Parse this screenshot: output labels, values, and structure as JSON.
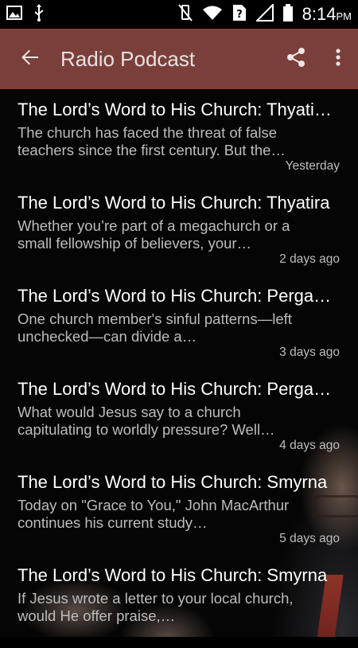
{
  "status_bar": {
    "time": "8:14",
    "ampm": "PM",
    "icons": [
      "image-icon",
      "usb-icon",
      "vibrate-off-icon",
      "wifi-icon",
      "sim-unknown-icon",
      "signal-icon",
      "battery-icon"
    ]
  },
  "app_bar": {
    "title": "Radio Podcast",
    "background": "#7b3f3b",
    "icons": [
      "back-arrow-icon",
      "share-icon",
      "more-vert-icon"
    ]
  },
  "episodes": [
    {
      "title": "The Lord’s Word to His Church: Thyati…",
      "description": "The church has faced the threat of false teachers since the first century. But the…",
      "date": "Yesterday"
    },
    {
      "title": "The Lord’s Word to His Church: Thyatira",
      "description": "Whether you’re part of a megachurch or a small fellowship of believers, your…",
      "date": "2 days ago"
    },
    {
      "title": "The Lord’s Word to His Church: Perga…",
      "description": "One church member's sinful patterns—left unchecked—can divide a…",
      "date": "3 days ago"
    },
    {
      "title": "The Lord’s Word to His Church: Perga…",
      "description": "What would Jesus say to a church capitulating to worldly pressure? Well…",
      "date": "4 days ago"
    },
    {
      "title": "The Lord’s Word to His Church: Smyrna",
      "description": "Today on \"Grace to You,\" John MacArthur continues his current study…",
      "date": "5 days ago"
    },
    {
      "title": "The Lord’s Word to His Church: Smyrna",
      "description": "If Jesus wrote a letter to your local church, would He offer praise,…",
      "date": ""
    }
  ]
}
